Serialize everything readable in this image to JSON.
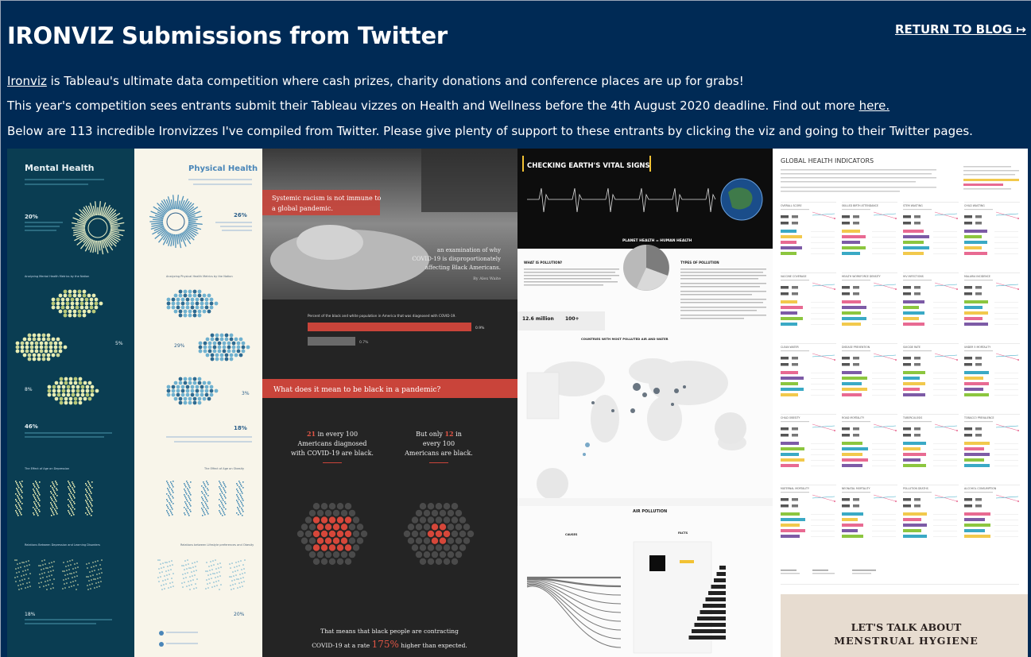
{
  "header": {
    "title": "IRONVIZ Submissions from Twitter",
    "return_link": "RETURN TO BLOG ↦"
  },
  "intro": {
    "line1_link": "Ironviz",
    "line1_rest": " is Tableau's ultimate data competition where cash prizes, charity donations and conference places are up for grabs!",
    "line2_text": "This year's competition sees entrants submit their Tableau vizzes on Health and Wellness before the 4th August 2020 deadline. Find out more ",
    "line2_link": "here.",
    "line3": "Below are 113 incredible Ironvizzes I've compiled from Twitter. Please give plenty of support to these entrants by clicking the viz and going to their Twitter pages."
  },
  "vizzes": {
    "mental": {
      "title": "Mental Health",
      "stat1": "20%",
      "section1": "Analyzing Mental Health Metrics by the Nation",
      "pct1": "5%",
      "pct2": "8%",
      "big_stat": "46%",
      "section2": "The Effect of Age on Depression",
      "section3": "Relations Between Depression and Learning Disorders",
      "stat3": "18%"
    },
    "physical": {
      "title": "Physical Health",
      "stat1": "26%",
      "section1": "Analyzing Physical Health Metrics by the Nation",
      "pct1": "29%",
      "pct2": "3%",
      "big_stat": "18%",
      "section2": "The Effect of Age on Obesity",
      "section3": "Relations between Lifestyle preferences and Obesity",
      "stat3": "20%"
    },
    "racism": {
      "headline": "Systemic racism is not immune to a global pandemic.",
      "subtitle": "an examination of why COVID-19 is disproportionately affecting Black Americans.",
      "byline": "By Alex Waite",
      "bar_caption": "Percent of the black and white population in America that was diagnosed with COVID-19.",
      "bar1_value": "0.9%",
      "bar2_value": "0.7%",
      "question": "What does it mean to be black in a pandemic?",
      "left_num": "21",
      "left_text": "in every 100 Americans diagnosed with COVID-19 are black.",
      "right_prefix": "But only",
      "right_num": "12",
      "right_text": "in every 100 Americans are black.",
      "footer_text": "That means that black people are contracting COVID-19 at a rate",
      "footer_num": "175%",
      "footer_suffix": "higher than expected."
    },
    "earth": {
      "banner": "CHECKING EARTH'S VITAL SIGNS",
      "subtitle": "PLANET HEALTH = HUMAN HEALTH",
      "section_what": "WHAT IS POLLUTION?",
      "section_types": "TYPES OF POLLUTION",
      "stat1": "12.6 million",
      "stat2": "100+",
      "map_title": "COUNTRIES WITH MOST POLLUTED AIR AND WATER",
      "air_title": "AIR POLLUTION",
      "causes": "CAUSES",
      "facts": "FACTS"
    },
    "global": {
      "title": "GLOBAL HEALTH INDICATORS",
      "panels": [
        "OVERALL SCORE",
        "SKILLED BIRTH ATTENDANCE",
        "STEM WASTING",
        "CHILD WASTING",
        "VACCINE COVERAGE",
        "HEALTH WORKFORCE DENSITY",
        "HIV INFECTIONS",
        "MALARIA INCIDENCE",
        "CLEAN WATER",
        "DISEASE PREVENTION",
        "SUICIDE RATE",
        "UNDER 5 MORTALITY",
        "CHILD OBESITY",
        "ROAD MORTALITY",
        "TUBERCULOSIS",
        "TOBACCO PREVALENCE",
        "MATERNAL MORTALITY",
        "NEONATAL MORTALITY",
        "POLLUTION DEATHS",
        "ALCOHOL CONSUMPTION"
      ],
      "menstrual_title_1": "LET'S TALK ABOUT",
      "menstrual_title_2": "MENSTRUAL HYGIENE"
    }
  }
}
